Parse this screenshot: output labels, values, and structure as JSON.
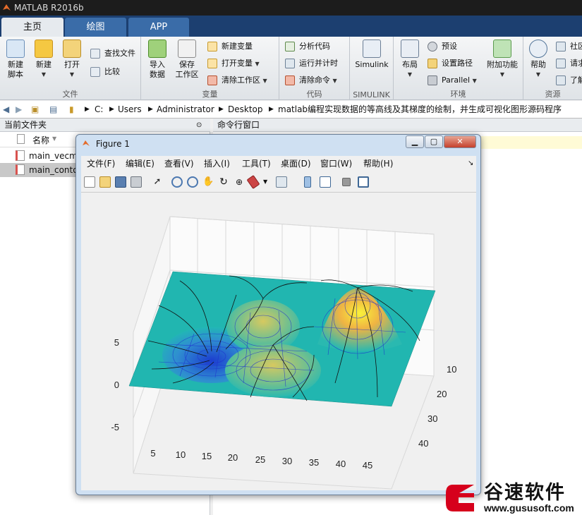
{
  "window": {
    "title": "MATLAB R2016b"
  },
  "tabs": [
    {
      "label": "主页"
    },
    {
      "label": "绘图"
    },
    {
      "label": "APP"
    }
  ],
  "ribbon": {
    "file": {
      "label": "文件",
      "new_script": "新建\n脚本",
      "new": "新建",
      "open": "打开",
      "find_files": "查找文件",
      "compare": "比较"
    },
    "variable": {
      "label": "变量",
      "import": "导入\n数据",
      "save_ws": "保存\n工作区",
      "new_var": "新建变量",
      "open_var": "打开变量",
      "clear_ws": "清除工作区"
    },
    "code": {
      "label": "代码",
      "analyze": "分析代码",
      "run_time": "运行并计时",
      "clear_cmd": "清除命令"
    },
    "simulink": {
      "label": "SIMULINK",
      "simulink": "Simulink"
    },
    "env": {
      "label": "环境",
      "layout": "布局",
      "prefs": "预设",
      "set_path": "设置路径",
      "parallel": "Parallel",
      "addons": "附加功能"
    },
    "resources": {
      "label": "资源",
      "help": "帮助",
      "community": "社区",
      "request": "请求",
      "learn": "了解"
    }
  },
  "address": {
    "parts": [
      "C:",
      "Users",
      "Administrator",
      "Desktop",
      "matlab编程实现数据的等高线及其梯度的绘制，并生成可视化图形源码程序"
    ]
  },
  "panels": {
    "current_folder": "当前文件夹",
    "name_col": "名称",
    "files": [
      "main_vecma",
      "main_conto"
    ],
    "command_window": "命令行窗口"
  },
  "figure": {
    "title": "Figure 1",
    "menu": [
      "文件(F)",
      "编辑(E)",
      "查看(V)",
      "插入(I)",
      "工具(T)",
      "桌面(D)",
      "窗口(W)",
      "帮助(H)"
    ],
    "axes": {
      "z_ticks": [
        "5",
        "0",
        "-5"
      ],
      "x_ticks": [
        "5",
        "10",
        "15",
        "20",
        "25",
        "30",
        "35",
        "40",
        "45"
      ],
      "y_ticks": [
        "10",
        "20",
        "30",
        "40"
      ]
    }
  },
  "watermark": {
    "brand": "谷速软件",
    "url": "www.gususoft.com"
  }
}
